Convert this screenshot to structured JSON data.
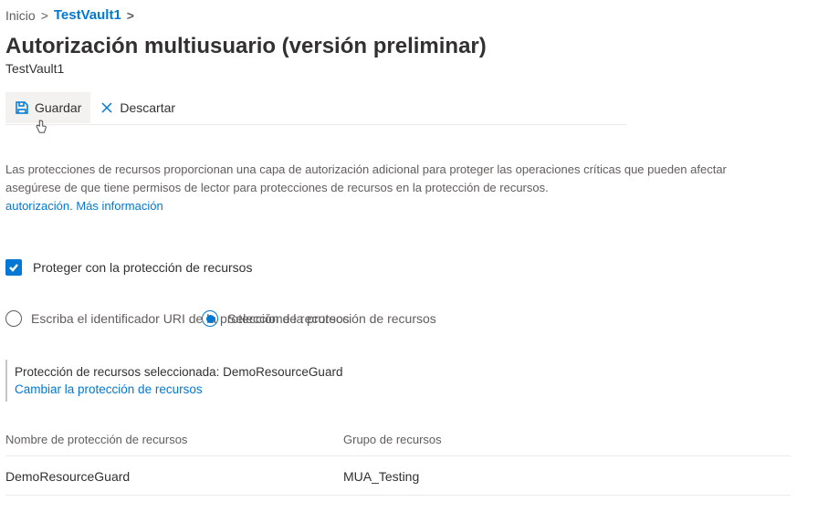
{
  "breadcrumb": {
    "home": "Inicio",
    "current": "TestVault1",
    "sep": ">"
  },
  "header": {
    "title": "Autorización multiusuario (versión preliminar)",
    "subtitle": "TestVault1"
  },
  "toolbar": {
    "save_label": "Guardar",
    "discard_label": "Descartar"
  },
  "description": {
    "line1": "Las protecciones de recursos proporcionan una capa de autorización adicional para proteger las operaciones críticas que pueden afectar",
    "line2": "asegúrese de que tiene permisos de lector para protecciones de recursos en la protección de recursos.",
    "link_prefix": "autorización.",
    "link_text": "Más información"
  },
  "checkbox": {
    "label": "Proteger con la protección de recursos",
    "checked": true
  },
  "radio": {
    "option1": "Escriba el identificador URI de la protección de recursos",
    "option2": "Seleccione la protección de recursos",
    "selected": "option2"
  },
  "selected_guard": {
    "label_prefix": "Protección de recursos seleccionada:",
    "name": "DemoResourceGuard",
    "change_link": "Cambiar la protección de recursos"
  },
  "table": {
    "headers": {
      "name": "Nombre de protección de recursos",
      "group": "Grupo de recursos"
    },
    "rows": [
      {
        "name": "DemoResourceGuard",
        "group": "MUA_Testing"
      }
    ]
  }
}
